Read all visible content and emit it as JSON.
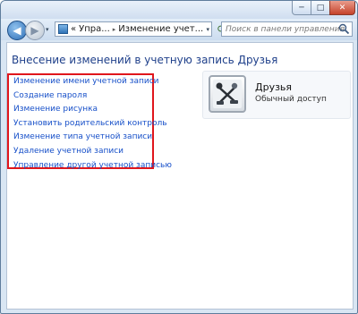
{
  "window": {
    "controls": {
      "minimize": "─",
      "maximize": "□",
      "close": "✕"
    }
  },
  "navbar": {
    "back_icon": "◀",
    "forward_icon": "▶",
    "recent_icon": "▾",
    "address": {
      "chevrons": "«",
      "part1": "Упра...",
      "sep": "▸",
      "part2": "Изменение учет...",
      "dropdown": "▾"
    },
    "refresh_icon": "⟳",
    "search_placeholder": "Поиск в панели управления"
  },
  "main": {
    "heading": "Внесение изменений в учетную запись Друзья",
    "tasks": [
      "Изменение имени учетной записи",
      "Создание пароля",
      "Изменение рисунка",
      "Установить родительский контроль",
      "Изменение типа учетной записи",
      "Удаление учетной записи",
      "Управление другой учетной записью"
    ],
    "account": {
      "name": "Друзья",
      "type": "Обычный доступ"
    }
  },
  "colors": {
    "highlight_border": "#e0161c",
    "link": "#1750c9",
    "heading": "#1e3f8a"
  }
}
